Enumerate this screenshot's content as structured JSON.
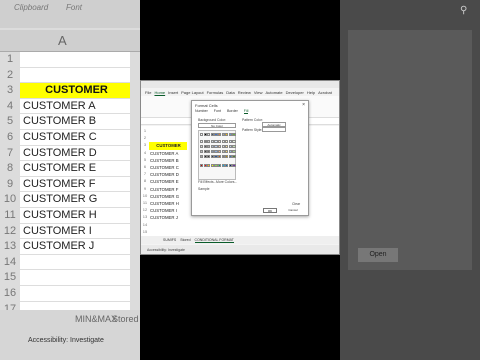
{
  "background_left": {
    "top_label_1": "Clipboard",
    "top_label_2": "Font",
    "column_letter": "A",
    "row_numbers": [
      "1",
      "2",
      "3",
      "4",
      "5",
      "6",
      "7",
      "8",
      "9",
      "10",
      "11",
      "12",
      "13",
      "14",
      "15",
      "16",
      "17"
    ],
    "cells": [
      "",
      "",
      "CUSTOMER",
      "CUSTOMER A",
      "CUSTOMER B",
      "CUSTOMER C",
      "CUSTOMER D",
      "CUSTOMER E",
      "CUSTOMER F",
      "CUSTOMER G",
      "CUSTOMER H",
      "CUSTOMER I",
      "CUSTOMER J",
      "",
      "",
      "",
      ""
    ],
    "tab_1": "MIN&MAX",
    "tab_2": "Stored",
    "status": "Accessibility: Investigate"
  },
  "background_right": {
    "top_icon": "search-icon",
    "button_label": "Open"
  },
  "app": {
    "menu": [
      "File",
      "Home",
      "Insert",
      "Page Layout",
      "Formulas",
      "Data",
      "Review",
      "View",
      "Automate",
      "Developer",
      "Help",
      "Acrobat"
    ],
    "active_menu": "Home",
    "sheet_rows": [
      "1",
      "2",
      "3",
      "4",
      "5",
      "6",
      "7",
      "8",
      "9",
      "10",
      "11",
      "12",
      "13",
      "14",
      "15"
    ],
    "sheet_cells": [
      "",
      "",
      "CUSTOMER",
      "CUSTOMER A",
      "CUSTOMER B",
      "CUSTOMER C",
      "CUSTOMER D",
      "CUSTOMER E",
      "CUSTOMER F",
      "CUSTOMER G",
      "CUSTOMER H",
      "CUSTOMER I",
      "CUSTOMER J",
      "",
      ""
    ],
    "sheet_tabs": [
      "SUMIFS",
      "Stored",
      "CONDITIONAL FORMAT"
    ],
    "active_sheet_tab": "CONDITIONAL FORMAT",
    "status": "Accessibility: Investigate"
  },
  "dialog": {
    "title": "Format Cells",
    "close": "×",
    "tabs": [
      "Number",
      "Font",
      "Border",
      "Fill"
    ],
    "active_tab": "Fill",
    "background_color_label": "Background Color:",
    "no_color": "No Color",
    "pattern_color_label": "Pattern Color:",
    "pattern_color_value": "Automatic",
    "pattern_style_label": "Pattern Style:",
    "fill_effects": "Fill Effects...",
    "more_colors": "More Colors...",
    "sample_label": "Sample",
    "clear_button": "Clear",
    "ok_button": "OK",
    "cancel_button": "Cancel",
    "palette_colors": [
      "#ffffff",
      "#000000",
      "#e7e6e6",
      "#44546a",
      "#4472c4",
      "#ed7d31",
      "#a5a5a5",
      "#ffc000",
      "#5b9bd5",
      "#70ad47",
      "#f2f2f2",
      "#7f7f7f",
      "#d0cece",
      "#d6dce4",
      "#d9e2f3",
      "#fbe5d5",
      "#ededed",
      "#fff2cc",
      "#deebf6",
      "#e2efd9",
      "#d8d8d8",
      "#595959",
      "#aeaaaa",
      "#adb9ca",
      "#b4c6e7",
      "#f7cbac",
      "#dbdbdb",
      "#fee599",
      "#bdd7ee",
      "#c5e0b3",
      "#bfbfbf",
      "#3f3f3f",
      "#757070",
      "#8496b0",
      "#8eaadb",
      "#f4b183",
      "#c9c9c9",
      "#ffd965",
      "#9cc3e5",
      "#a8d08d",
      "#a5a5a5",
      "#262626",
      "#3a3838",
      "#323f4f",
      "#2f5496",
      "#c55a11",
      "#7b7b7b",
      "#bf9000",
      "#2e75b5",
      "#538135",
      "#c00000",
      "#ff0000",
      "#ffc000",
      "#ffff00",
      "#92d050",
      "#00b050",
      "#00b0f0",
      "#0070c0",
      "#002060",
      "#7030a0"
    ]
  }
}
